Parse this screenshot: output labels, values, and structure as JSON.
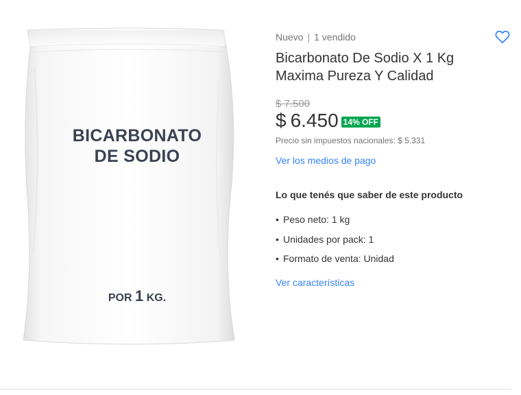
{
  "product": {
    "condition": "Nuevo",
    "separator": "|",
    "sold": "1 vendido",
    "title": "Bicarbonato De Sodio X 1 Kg Maxima Pureza Y Calidad",
    "favorite_icon": "heart-outline-icon"
  },
  "image": {
    "line1": "BICARBONATO",
    "line2": "DE SODIO",
    "qty_prefix": "POR",
    "qty_number": "1",
    "qty_suffix": "KG."
  },
  "pricing": {
    "old_price": "$ 7.500",
    "currency": "$",
    "price": "6.450",
    "discount": "14% OFF",
    "tax_text": "Precio sin impuestos nacionales: $ 5.331",
    "payment_link": "Ver los medios de pago"
  },
  "highlights": {
    "title": "Lo que tenés que saber de este producto",
    "items": [
      "Peso neto: 1 kg",
      "Unidades por pack: 1",
      "Formato de venta: Unidad"
    ],
    "link": "Ver características"
  },
  "colors": {
    "accent": "#3483fa",
    "discount_bg": "#00a650",
    "bag_text": "#3b4150"
  }
}
